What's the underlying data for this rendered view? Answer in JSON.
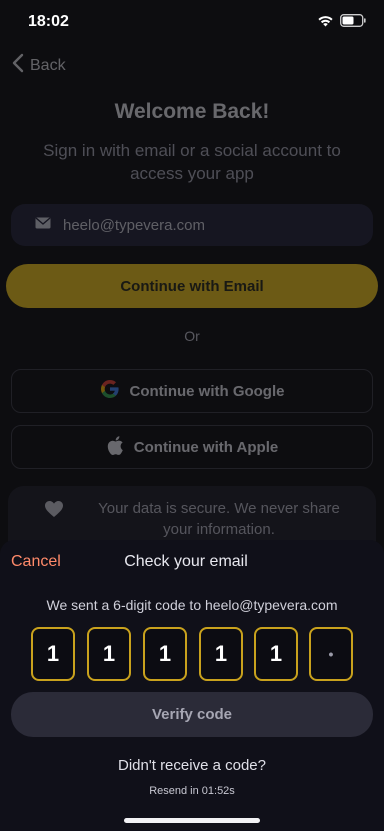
{
  "status": {
    "time": "18:02"
  },
  "nav": {
    "back_label": "Back"
  },
  "signin": {
    "title": "Welcome Back!",
    "subtitle": "Sign in with email or a social account to access your app",
    "email_value": "heelo@typevera.com",
    "continue_email_label": "Continue with Email",
    "or_label": "Or",
    "google_label": "Continue with Google",
    "apple_label": "Continue with Apple",
    "secure_text": "Your data is secure. We never share your information."
  },
  "sheet": {
    "cancel_label": "Cancel",
    "title": "Check your email",
    "info": "We sent a 6-digit code to heelo@typevera.com",
    "digits": [
      "1",
      "1",
      "1",
      "1",
      "1",
      "•"
    ],
    "verify_label": "Verify code",
    "resend_question": "Didn't receive a code?",
    "resend_timer": "Resend in 01:52s"
  },
  "colors": {
    "accent": "#f0c41c",
    "cancel": "#ff8a6a",
    "code_border": "#c9a21d"
  },
  "icons": [
    "back-chevron-icon",
    "mail-icon",
    "google-icon",
    "apple-icon",
    "heart-icon",
    "wifi-icon",
    "battery-icon",
    "signal-icon"
  ]
}
